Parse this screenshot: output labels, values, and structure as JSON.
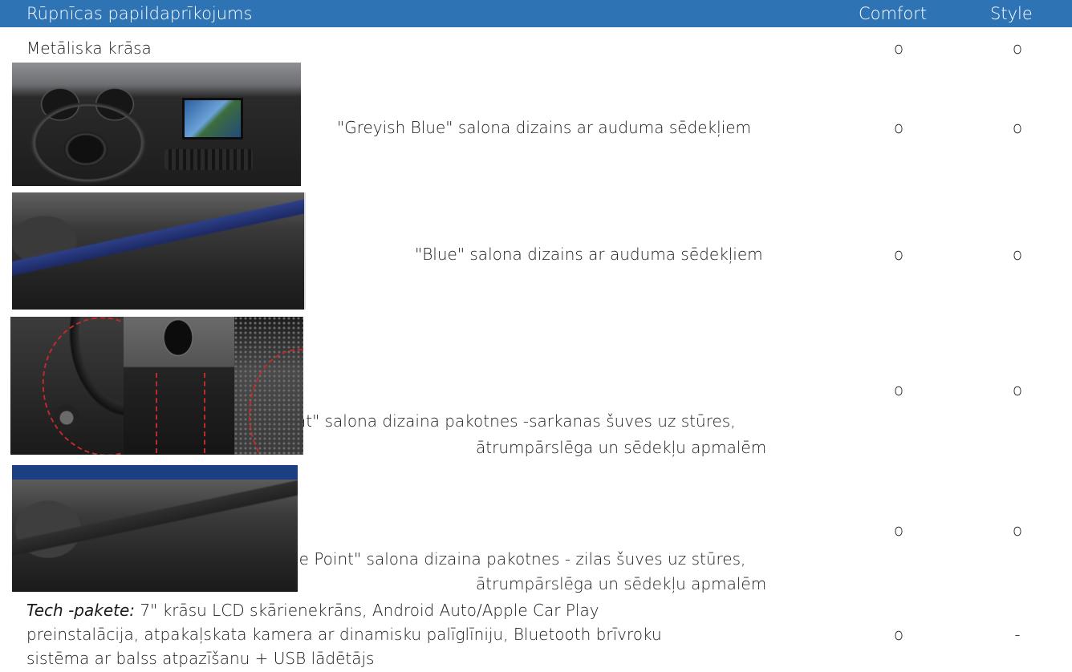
{
  "header": {
    "title": "Rūpnīcas papildaprīkojums",
    "columns": [
      "Comfort",
      "Style"
    ]
  },
  "colors": {
    "header_background": "#2e74b5",
    "header_text": "#ffffff",
    "body_text": "#1a1a1a"
  },
  "rows": [
    {
      "label": "Metāliska krāsa",
      "comfort": "o",
      "style": "o"
    },
    {
      "label": "\"Greyish Blue\" salona dizains ar auduma sēdekļiem",
      "comfort": "o",
      "style": "o"
    },
    {
      "label": "\"Blue\" salona dizains ar auduma sēdekļiem",
      "comfort": "o",
      "style": "o"
    },
    {
      "label_line1": "int\" salona dizaina pakotnes -sarkanas šuves uz stūres,",
      "label_line2": "ātrumpārslēga un sēdekļu apmalēm",
      "comfort": "o",
      "style": "o"
    },
    {
      "label_line1": "ue Point\" salona dizaina pakotnes - zilas šuves uz stūres,",
      "label_line2": "ātrumpārslēga un sēdekļu apmalēm",
      "comfort": "o",
      "style": "o"
    },
    {
      "label_italic": "Tech -pakete:",
      "label_line1_rest": " 7\" krāsu LCD skārienekrāns, Android Auto/Apple Car Play",
      "label_line2": "preinstalācija, atpakaļskata kamera ar dinamisku palīglīniju, Bluetooth brīvroku",
      "label_line3": "sistēma ar balss atpazīšanu + USB lādētājs",
      "comfort": "o",
      "style": "-"
    }
  ]
}
